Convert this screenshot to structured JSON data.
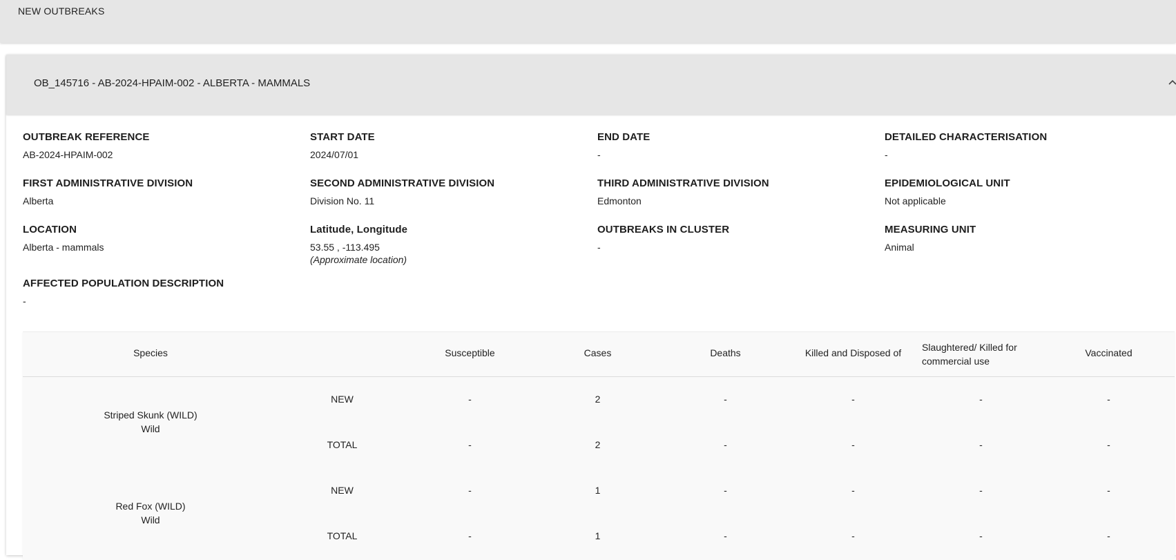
{
  "page": {
    "title": "NEW OUTBREAKS"
  },
  "outbreak": {
    "heading": "OB_145716 - AB-2024-HPAIM-002 - ALBERTA - MAMMALS",
    "fields": {
      "outbreak_reference": {
        "label": "OUTBREAK REFERENCE",
        "value": "AB-2024-HPAIM-002"
      },
      "start_date": {
        "label": "START DATE",
        "value": "2024/07/01"
      },
      "end_date": {
        "label": "END DATE",
        "value": "-"
      },
      "detailed_characterisation": {
        "label": "DETAILED CHARACTERISATION",
        "value": "-"
      },
      "first_admin_division": {
        "label": "FIRST ADMINISTRATIVE DIVISION",
        "value": "Alberta"
      },
      "second_admin_division": {
        "label": "SECOND ADMINISTRATIVE DIVISION",
        "value": "Division No. 11"
      },
      "third_admin_division": {
        "label": "THIRD ADMINISTRATIVE DIVISION",
        "value": "Edmonton"
      },
      "epidemiological_unit": {
        "label": "EPIDEMIOLOGICAL UNIT",
        "value": "Not applicable"
      },
      "location": {
        "label": "LOCATION",
        "value": "Alberta - mammals"
      },
      "lat_long": {
        "label": "Latitude, Longitude",
        "value": "53.55 , -113.495",
        "note": "(Approximate location)"
      },
      "outbreaks_in_cluster": {
        "label": "OUTBREAKS IN CLUSTER",
        "value": "-"
      },
      "measuring_unit": {
        "label": "MEASURING UNIT",
        "value": "Animal"
      },
      "affected_population": {
        "label": "AFFECTED POPULATION DESCRIPTION",
        "value": "-"
      }
    }
  },
  "table": {
    "headers": {
      "species": "Species",
      "susceptible": "Susceptible",
      "cases": "Cases",
      "deaths": "Deaths",
      "killed_disposed": "Killed and Disposed of",
      "slaughtered": "Slaughtered/ Killed for commercial use",
      "vaccinated": "Vaccinated"
    },
    "rows": [
      {
        "species": "Striped Skunk (WILD)",
        "category": "Wild",
        "new": {
          "label": "NEW",
          "susceptible": "-",
          "cases": "2",
          "deaths": "-",
          "killed_disposed": "-",
          "slaughtered": "-",
          "vaccinated": "-"
        },
        "total": {
          "label": "TOTAL",
          "susceptible": "-",
          "cases": "2",
          "deaths": "-",
          "killed_disposed": "-",
          "slaughtered": "-",
          "vaccinated": "-"
        }
      },
      {
        "species": "Red Fox (WILD)",
        "category": "Wild",
        "new": {
          "label": "NEW",
          "susceptible": "-",
          "cases": "1",
          "deaths": "-",
          "killed_disposed": "-",
          "slaughtered": "-",
          "vaccinated": "-"
        },
        "total": {
          "label": "TOTAL",
          "susceptible": "-",
          "cases": "1",
          "deaths": "-",
          "killed_disposed": "-",
          "slaughtered": "-",
          "vaccinated": "-"
        }
      }
    ]
  }
}
